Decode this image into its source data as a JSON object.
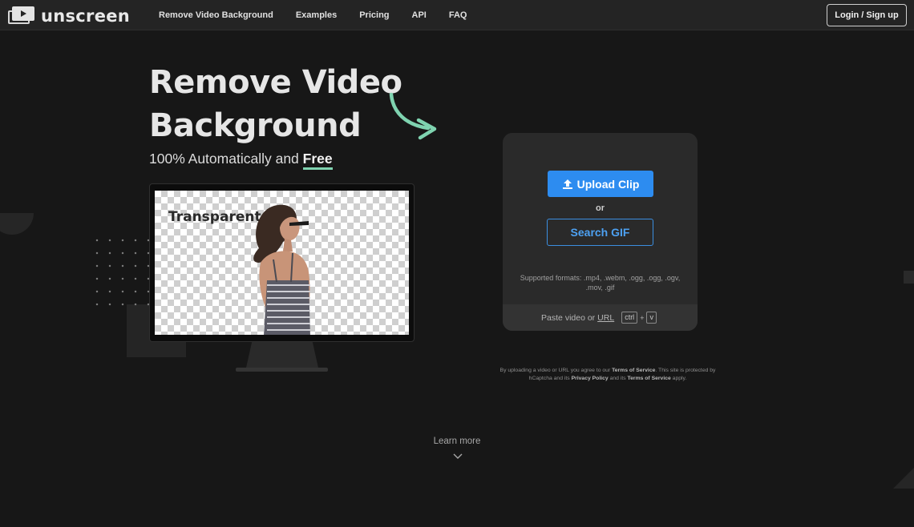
{
  "nav": {
    "brand": "unscreen",
    "links": [
      "Remove Video Background",
      "Examples",
      "Pricing",
      "API",
      "FAQ"
    ],
    "login": "Login / Sign up"
  },
  "hero": {
    "title_line1": "Remove Video",
    "title_line2": "Background",
    "subtitle_prefix": "100% Automatically and ",
    "subtitle_highlight": "Free",
    "preview_label": "Transparent"
  },
  "upload": {
    "upload_button": "Upload Clip",
    "or": "or",
    "search_button": "Search GIF",
    "formats": "Supported formats: .mp4, .webm, .ogg, .ogg, .ogv, .mov, .gif",
    "paste_prefix": "Paste video or",
    "paste_url": "URL",
    "key_ctrl": "ctrl",
    "key_plus": "+",
    "key_v": "v"
  },
  "terms": {
    "t1": "By uploading a video or URL you agree to our ",
    "tos1": "Terms of Service",
    "t2": ". This site is protected by hCaptcha and its ",
    "privacy": "Privacy Policy",
    "t3": " and its ",
    "tos2": "Terms of Service",
    "t4": " apply."
  },
  "footer": {
    "learn_more": "Learn more"
  },
  "colors": {
    "background": "#171717",
    "navbar": "#242424",
    "accent_blue": "#2d8cf0",
    "accent_green": "#7fd3b0",
    "card": "#2a2a2a"
  },
  "icons": [
    "logo-icon",
    "upload-icon",
    "curved-arrow-icon",
    "chevron-down-icon"
  ]
}
